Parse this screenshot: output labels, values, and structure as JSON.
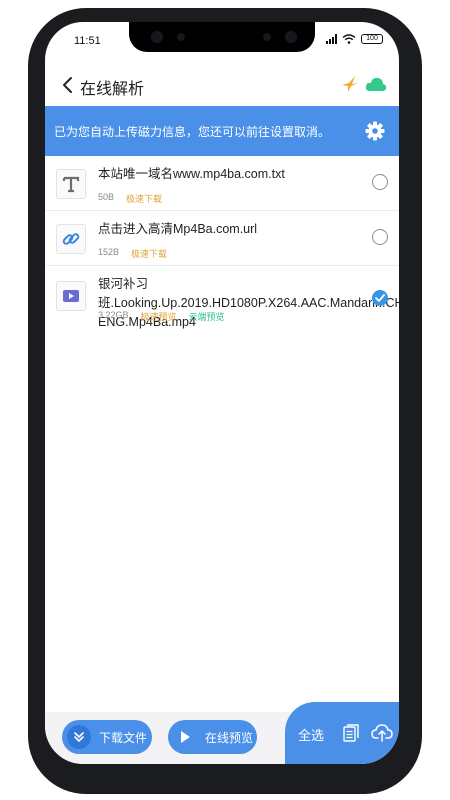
{
  "status_bar": {
    "time": "11:51",
    "battery": "100"
  },
  "header": {
    "title": "在线解析"
  },
  "banner": {
    "text": "已为您自动上传磁力信息，您还可以前往设置取消。"
  },
  "files": [
    {
      "name": "本站唯一域名www.mp4ba.com.txt",
      "size": "50B",
      "tags": [
        "极速下载"
      ],
      "icon": "text-file-icon",
      "selected": false
    },
    {
      "name": "点击进入高清Mp4Ba.com.url",
      "size": "152B",
      "tags": [
        "极速下载"
      ],
      "icon": "link-icon",
      "selected": false
    },
    {
      "name": "银河补习班.Looking.Up.2019.HD1080P.X264.AAC.Mandarin.CHS-ENG.Mp4Ba.mp4",
      "size": "3.22GB",
      "tags": [
        "极速预览",
        "云端预览"
      ],
      "icon": "video-file-icon",
      "selected": true
    }
  ],
  "bottom": {
    "download_label": "下载文件",
    "preview_label": "在线预览",
    "select_all_label": "全选"
  },
  "colors": {
    "accent": "#4a90e8",
    "fast_tag": "#e2a23a",
    "cloud_tag": "#2fbf8f",
    "selected_check": "#3b95e6"
  }
}
